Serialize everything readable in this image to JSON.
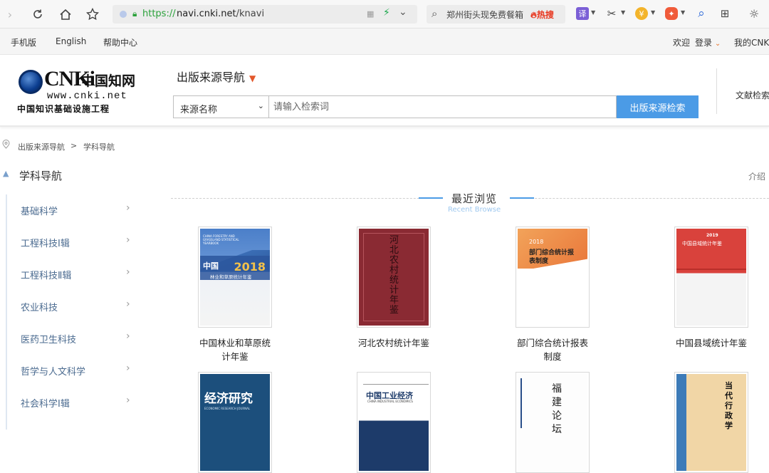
{
  "browser": {
    "url_scheme": "https://",
    "url_host": "navi.cnki.net",
    "url_path": "/knavi",
    "search_query": "郑州街头现免费餐箱",
    "hot_label": "热搜",
    "translate_label": "译"
  },
  "top_nav": {
    "links": [
      "手机版",
      "English",
      "帮助中心"
    ],
    "welcome": "欢迎",
    "login": "登录",
    "my_cnki": "我的CNKI"
  },
  "logo": {
    "brand": "CNKi",
    "cn_name": "中国知网",
    "site": "www.cnki.net",
    "slogan": "中国知识基础设施工程"
  },
  "header": {
    "nav_title": "出版来源导航",
    "source_select": "来源名称",
    "search_placeholder": "请输入检索词",
    "search_button": "出版来源检索",
    "literature_search": "文献检索"
  },
  "breadcrumb": {
    "items": [
      "出版来源导航",
      "学科导航"
    ],
    "separator": ">"
  },
  "subject_nav": {
    "title": "学科导航",
    "intro": "介绍",
    "items": [
      {
        "label": "基础科学"
      },
      {
        "label": "工程科技Ⅰ辑"
      },
      {
        "label": "工程科技Ⅱ辑"
      },
      {
        "label": "农业科技"
      },
      {
        "label": "医药卫生科技"
      },
      {
        "label": "哲学与人文科学"
      },
      {
        "label": "社会科学Ⅰ辑"
      }
    ]
  },
  "recent_browse": {
    "title_cn": "最近浏览",
    "title_en": "Recent Browse",
    "books": [
      {
        "title": "中国林业和草原统计年鉴",
        "cover_year": "2018",
        "cover_text": "林业和草原统计年鉴",
        "cover_prefix": "中国",
        "cover_en": "CHINA FORESTRY AND GRASSLAND STATISTICAL YEARBOOK"
      },
      {
        "title": "河北农村统计年鉴",
        "cover_text": "河北农村统计年鉴"
      },
      {
        "title": "部门综合统计报表制度",
        "cover_year": "2018",
        "cover_text": "部门综合统计报表制度"
      },
      {
        "title": "中国县域统计年鉴",
        "cover_year": "2019",
        "cover_text": "中国县域统计年鉴"
      },
      {
        "title": "",
        "cover_text": "经济研究",
        "cover_en": "ECONOMIC RESEARCH JOURNAL"
      },
      {
        "title": "",
        "cover_text": "中国工业经济",
        "cover_en": "CHINA INDUSTRIAL ECONOMICS"
      },
      {
        "title": "",
        "cover_text": "福建论坛"
      },
      {
        "title": "",
        "cover_text": "当代行政学"
      }
    ]
  },
  "colors": {
    "accent_blue": "#4b9be6",
    "nav_triangle": "#e3572b",
    "link_green": "#2aa13a"
  }
}
